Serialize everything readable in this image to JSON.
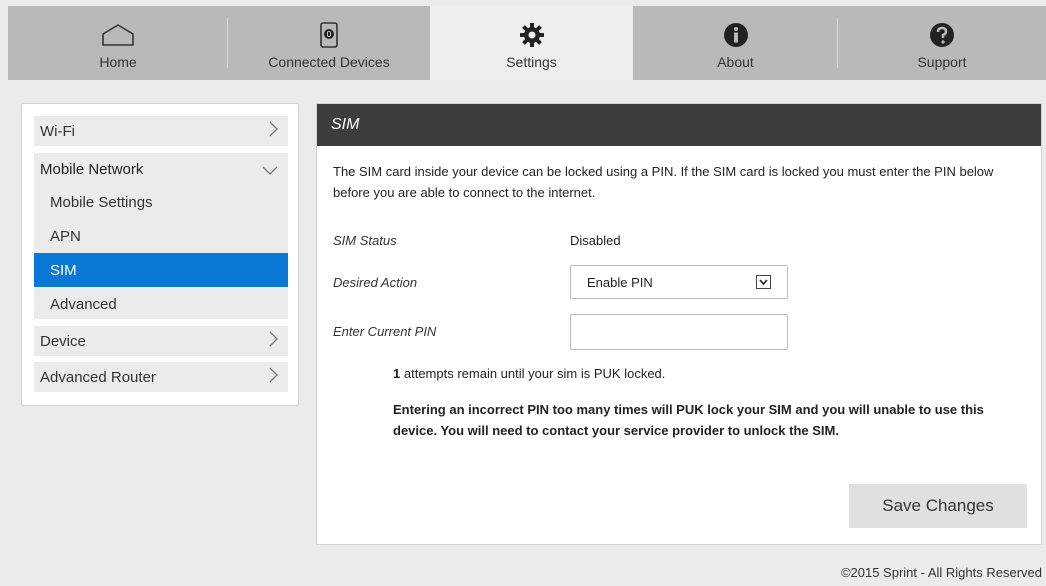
{
  "nav": {
    "tabs": [
      {
        "label": "Home",
        "icon": "home-icon"
      },
      {
        "label": "Connected Devices",
        "icon": "device-count-icon",
        "badge": "0"
      },
      {
        "label": "Settings",
        "icon": "gear-icon"
      },
      {
        "label": "About",
        "icon": "info-icon"
      },
      {
        "label": "Support",
        "icon": "help-icon"
      }
    ],
    "active_tab": "Settings"
  },
  "sidebar": {
    "items": [
      {
        "label": "Wi-Fi"
      },
      {
        "label": "Mobile Network"
      },
      {
        "label": "Device"
      },
      {
        "label": "Advanced Router"
      }
    ],
    "sub_items": [
      {
        "label": "Mobile Settings"
      },
      {
        "label": "APN"
      },
      {
        "label": "SIM"
      },
      {
        "label": "Advanced"
      }
    ],
    "active_sub": "SIM"
  },
  "panel": {
    "title": "SIM",
    "description": "The SIM card inside your device can be locked using a PIN. If the SIM card is locked you must enter the PIN below before you are able to connect to the internet.",
    "sim_status_label": "SIM Status",
    "sim_status_value": "Disabled",
    "desired_action_label": "Desired Action",
    "desired_action_value": "Enable PIN",
    "current_pin_label": "Enter Current PIN",
    "current_pin_value": "",
    "attempts_count": "1",
    "attempts_text": "attempts remain until your sim is PUK locked.",
    "warning": "Entering an incorrect PIN too many times will PUK lock your SIM and you will unable to use this device. You will need to contact your service provider to unlock the SIM.",
    "save_label": "Save Changes"
  },
  "footer": {
    "text": "©2015 Sprint - All Rights Reserved"
  },
  "colors": {
    "nav_bg": "#b9b9b9",
    "active_tab_bg": "#eeeeee",
    "panel_header_bg": "#3d3d3d",
    "selected_item_bg": "#0a78d7"
  }
}
